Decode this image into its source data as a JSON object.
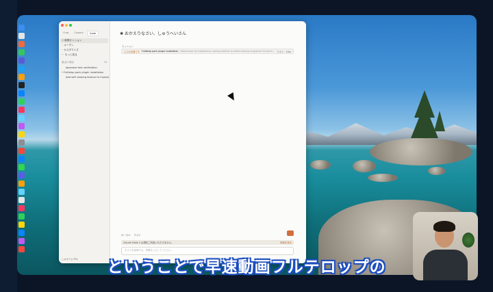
{
  "app": {
    "tabs": [
      "Chat",
      "Cowork",
      "Code"
    ],
    "active_tab": "Code"
  },
  "sidebar": {
    "nav_items": [
      {
        "label": "新規セッション",
        "icon": "plus-icon",
        "selected": true
      },
      {
        "label": "ルーチン",
        "icon": "routine-icon",
        "selected": false
      },
      {
        "label": "カスタマイズ",
        "icon": "customize-icon",
        "selected": false
      },
      {
        "label": "もっと見る",
        "icon": "more-icon",
        "selected": false
      }
    ],
    "recent_label": "最近の項目",
    "recent_count": "All",
    "recents": [
      "Japanese text verification",
      "Fulltelop pack plugin installation",
      "Add skill viewing feature to Cowork"
    ],
    "user": "しゅうへい Pro"
  },
  "main": {
    "greeting": "おかえりなさい、しゅうへいさん",
    "section_label": "セッション",
    "session": {
      "status": "入力が必要です",
      "title": "Fulltelop pack plugin installation",
      "detail": "Rolled back all installations; asking whether to delete backup snapshots for Jarvis...",
      "meta": "テスト · 19m"
    },
    "composer_options": [
      "ローカル",
      "テスト"
    ],
    "banner_text": "Claude Fable 2 は現在ご利用いただけません。",
    "banner_link": "詳細を見る",
    "input_placeholder": "タスクを説明する、質問を入力してください。"
  },
  "overlay": {
    "subtitle": "ということで早速動画フルテロップの"
  }
}
